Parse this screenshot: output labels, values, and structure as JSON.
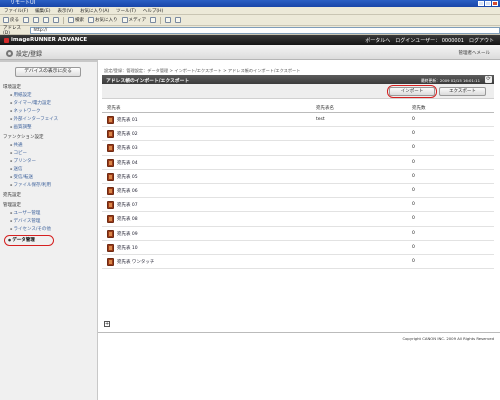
{
  "window": {
    "title": "リモートUI"
  },
  "menubar": [
    "ファイル(F)",
    "編集(E)",
    "表示(V)",
    "お気に入り(A)",
    "ツール(T)",
    "ヘルプ(H)"
  ],
  "toolbar": {
    "back": "戻る",
    "search": "検索",
    "favorites": "お気に入り",
    "media": "メディア"
  },
  "address": {
    "label": "アドレス(D)",
    "value": "http://"
  },
  "app": {
    "brand": "imageRUNNER ADVANCE",
    "portal_link": "ポータルへ",
    "login_user": "ログインユーザー： 0000001",
    "logout": "ログアウト"
  },
  "settings": {
    "title": "設定/登録",
    "admin_mail": "管理者へメール"
  },
  "sidebar": {
    "restore_button": "デバイスの表示に戻る",
    "sections": [
      {
        "label": "環境設定",
        "items": [
          "用紙設定",
          "タイマー/電力設定",
          "ネットワーク",
          "外部インターフェイス",
          "画質調整"
        ]
      },
      {
        "label": "ファンクション設定",
        "items": [
          "共通",
          "コピー",
          "プリンター",
          "送信",
          "受信/転送",
          "ファイル保存/利用"
        ]
      },
      {
        "label": "宛先設定",
        "items": []
      },
      {
        "label": "管理設定",
        "items": [
          "ユーザー管理",
          "デバイス管理",
          "ライセンス/その他",
          "データ管理"
        ]
      }
    ]
  },
  "main": {
    "breadcrumb": "設定/登録：管理設定：データ管理 > インポート/エクスポート > アドレス帳のインポート/エクスポート",
    "panel_title": "アドレス帳のインポート/エクスポート",
    "last_updated": "最終更新：2009 02/15 16:01:11",
    "import_button": "インポート",
    "export_button": "エクスポート",
    "columns": [
      "宛先表",
      "宛先表名",
      "宛先数"
    ],
    "rows": [
      {
        "name": "宛先表 01",
        "list_name": "test",
        "count": "0"
      },
      {
        "name": "宛先表 02",
        "list_name": "",
        "count": "0"
      },
      {
        "name": "宛先表 03",
        "list_name": "",
        "count": "0"
      },
      {
        "name": "宛先表 04",
        "list_name": "",
        "count": "0"
      },
      {
        "name": "宛先表 05",
        "list_name": "",
        "count": "0"
      },
      {
        "name": "宛先表 06",
        "list_name": "",
        "count": "0"
      },
      {
        "name": "宛先表 07",
        "list_name": "",
        "count": "0"
      },
      {
        "name": "宛先表 08",
        "list_name": "",
        "count": "0"
      },
      {
        "name": "宛先表 09",
        "list_name": "",
        "count": "0"
      },
      {
        "name": "宛先表 10",
        "list_name": "",
        "count": "0"
      },
      {
        "name": "宛先表 ワンタッチ",
        "list_name": "",
        "count": "0"
      }
    ],
    "copyright": "Copyright CANON INC. 2009 All Rights Reserved"
  },
  "colors": {
    "accent": "#d52020",
    "header_dark": "#1a1a1a",
    "link": "#3a5f9a"
  }
}
